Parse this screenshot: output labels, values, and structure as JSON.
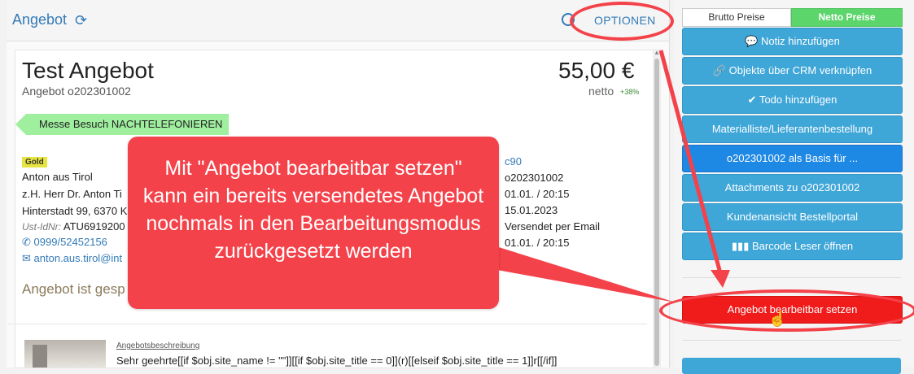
{
  "header": {
    "title": "Angebot",
    "options_label": "OPTIONEN"
  },
  "document": {
    "title": "Test Angebot",
    "subtitle": "Angebot o202301002",
    "price": "55,00 €",
    "netto_label": "netto",
    "netto_pct": "+38%",
    "tag": "Messe Besuch NACHTELEFONIEREN",
    "gold_badge": "Gold",
    "addr_line1": "Anton aus Tirol",
    "addr_line2": "z.H. Herr Dr. Anton Ti",
    "addr_line3": "Hinterstadt 99, 6370 K",
    "ust_label": "Ust-IdNr:",
    "ust_value": "ATU6919200",
    "phone": "0999/52452156",
    "email": "anton.aus.tirol@int",
    "right_col": [
      "c90",
      "o202301002",
      "01.01. / 20:15",
      "15.01.2023",
      "Versendet per Email",
      "01.01. / 20:15"
    ],
    "status": "Angebot ist gesp",
    "desc_label": "Angebotsbeschreibung",
    "desc_text": "Sehr geehrte[[if $obj.site_name != \"\"]][[if $obj.site_title == 0]](r)[[elseif $obj.site_title == 1]]r[[/if]]"
  },
  "callout": {
    "text": "Mit \"Angebot bearbeitbar setzen\" kann ein bereits versendetes Angebot nochmals in den Bearbeitungsmodus zurückgesetzt werden"
  },
  "sidebar": {
    "brutto_label": "Brutto Preise",
    "netto_label": "Netto Preise",
    "buttons": [
      "Notiz hinzufügen",
      "Objekte über CRM verknüpfen",
      "Todo hinzufügen",
      "Materialliste/Lieferantenbestellung",
      "o202301002 als Basis für ...",
      "Attachments zu o202301002",
      "Kundenansicht Bestellportal",
      "Barcode Leser öffnen"
    ],
    "edit_button": "Angebot bearbeitbar setzen"
  },
  "colors": {
    "accent_blue": "#337ab7",
    "callout_red": "#f3424a",
    "button_blue": "#3fa6d8",
    "netto_green": "#5cd56b"
  }
}
